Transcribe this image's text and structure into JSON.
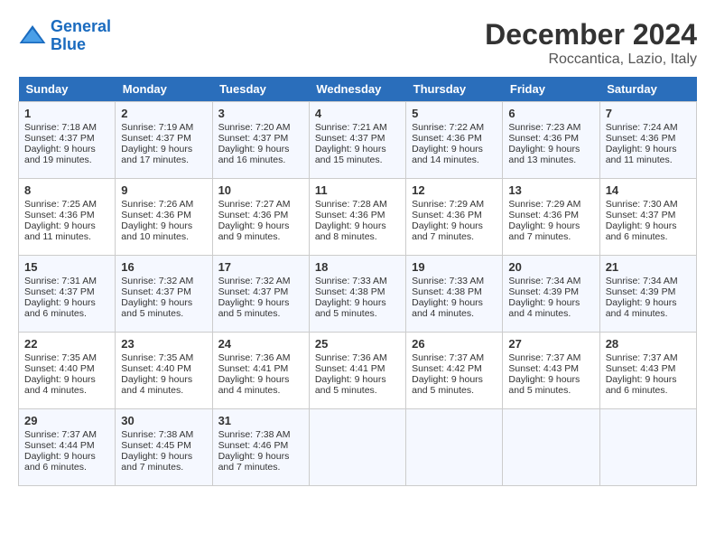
{
  "header": {
    "logo_line1": "General",
    "logo_line2": "Blue",
    "month": "December 2024",
    "location": "Roccantica, Lazio, Italy"
  },
  "weekdays": [
    "Sunday",
    "Monday",
    "Tuesday",
    "Wednesday",
    "Thursday",
    "Friday",
    "Saturday"
  ],
  "weeks": [
    [
      {
        "day": "1",
        "sunrise": "7:18 AM",
        "sunset": "4:37 PM",
        "daylight": "9 hours and 19 minutes."
      },
      {
        "day": "2",
        "sunrise": "7:19 AM",
        "sunset": "4:37 PM",
        "daylight": "9 hours and 17 minutes."
      },
      {
        "day": "3",
        "sunrise": "7:20 AM",
        "sunset": "4:37 PM",
        "daylight": "9 hours and 16 minutes."
      },
      {
        "day": "4",
        "sunrise": "7:21 AM",
        "sunset": "4:37 PM",
        "daylight": "9 hours and 15 minutes."
      },
      {
        "day": "5",
        "sunrise": "7:22 AM",
        "sunset": "4:36 PM",
        "daylight": "9 hours and 14 minutes."
      },
      {
        "day": "6",
        "sunrise": "7:23 AM",
        "sunset": "4:36 PM",
        "daylight": "9 hours and 13 minutes."
      },
      {
        "day": "7",
        "sunrise": "7:24 AM",
        "sunset": "4:36 PM",
        "daylight": "9 hours and 11 minutes."
      }
    ],
    [
      {
        "day": "8",
        "sunrise": "7:25 AM",
        "sunset": "4:36 PM",
        "daylight": "9 hours and 11 minutes."
      },
      {
        "day": "9",
        "sunrise": "7:26 AM",
        "sunset": "4:36 PM",
        "daylight": "9 hours and 10 minutes."
      },
      {
        "day": "10",
        "sunrise": "7:27 AM",
        "sunset": "4:36 PM",
        "daylight": "9 hours and 9 minutes."
      },
      {
        "day": "11",
        "sunrise": "7:28 AM",
        "sunset": "4:36 PM",
        "daylight": "9 hours and 8 minutes."
      },
      {
        "day": "12",
        "sunrise": "7:29 AM",
        "sunset": "4:36 PM",
        "daylight": "9 hours and 7 minutes."
      },
      {
        "day": "13",
        "sunrise": "7:29 AM",
        "sunset": "4:36 PM",
        "daylight": "9 hours and 7 minutes."
      },
      {
        "day": "14",
        "sunrise": "7:30 AM",
        "sunset": "4:37 PM",
        "daylight": "9 hours and 6 minutes."
      }
    ],
    [
      {
        "day": "15",
        "sunrise": "7:31 AM",
        "sunset": "4:37 PM",
        "daylight": "9 hours and 6 minutes."
      },
      {
        "day": "16",
        "sunrise": "7:32 AM",
        "sunset": "4:37 PM",
        "daylight": "9 hours and 5 minutes."
      },
      {
        "day": "17",
        "sunrise": "7:32 AM",
        "sunset": "4:37 PM",
        "daylight": "9 hours and 5 minutes."
      },
      {
        "day": "18",
        "sunrise": "7:33 AM",
        "sunset": "4:38 PM",
        "daylight": "9 hours and 5 minutes."
      },
      {
        "day": "19",
        "sunrise": "7:33 AM",
        "sunset": "4:38 PM",
        "daylight": "9 hours and 4 minutes."
      },
      {
        "day": "20",
        "sunrise": "7:34 AM",
        "sunset": "4:39 PM",
        "daylight": "9 hours and 4 minutes."
      },
      {
        "day": "21",
        "sunrise": "7:34 AM",
        "sunset": "4:39 PM",
        "daylight": "9 hours and 4 minutes."
      }
    ],
    [
      {
        "day": "22",
        "sunrise": "7:35 AM",
        "sunset": "4:40 PM",
        "daylight": "9 hours and 4 minutes."
      },
      {
        "day": "23",
        "sunrise": "7:35 AM",
        "sunset": "4:40 PM",
        "daylight": "9 hours and 4 minutes."
      },
      {
        "day": "24",
        "sunrise": "7:36 AM",
        "sunset": "4:41 PM",
        "daylight": "9 hours and 4 minutes."
      },
      {
        "day": "25",
        "sunrise": "7:36 AM",
        "sunset": "4:41 PM",
        "daylight": "9 hours and 5 minutes."
      },
      {
        "day": "26",
        "sunrise": "7:37 AM",
        "sunset": "4:42 PM",
        "daylight": "9 hours and 5 minutes."
      },
      {
        "day": "27",
        "sunrise": "7:37 AM",
        "sunset": "4:43 PM",
        "daylight": "9 hours and 5 minutes."
      },
      {
        "day": "28",
        "sunrise": "7:37 AM",
        "sunset": "4:43 PM",
        "daylight": "9 hours and 6 minutes."
      }
    ],
    [
      {
        "day": "29",
        "sunrise": "7:37 AM",
        "sunset": "4:44 PM",
        "daylight": "9 hours and 6 minutes."
      },
      {
        "day": "30",
        "sunrise": "7:38 AM",
        "sunset": "4:45 PM",
        "daylight": "9 hours and 7 minutes."
      },
      {
        "day": "31",
        "sunrise": "7:38 AM",
        "sunset": "4:46 PM",
        "daylight": "9 hours and 7 minutes."
      },
      null,
      null,
      null,
      null
    ]
  ]
}
